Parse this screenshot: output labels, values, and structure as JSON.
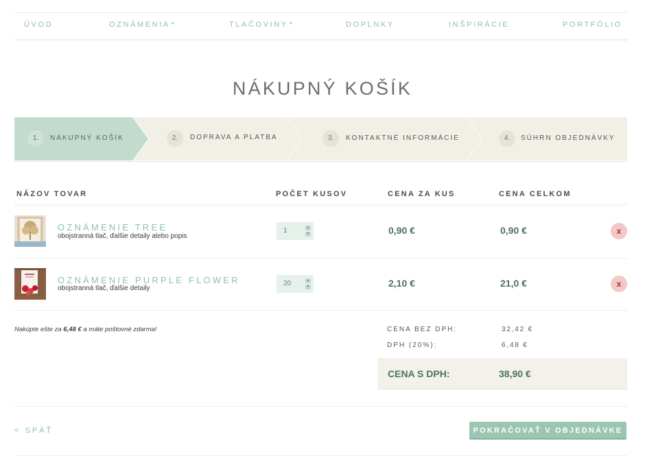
{
  "nav": {
    "items": [
      {
        "label": "ÚVOD",
        "has_dropdown": false
      },
      {
        "label": "OZNÁMENIA",
        "has_dropdown": true
      },
      {
        "label": "TLAČOVINY",
        "has_dropdown": true
      },
      {
        "label": "DOPLNKY",
        "has_dropdown": false
      },
      {
        "label": "INŠPIRÁCIE",
        "has_dropdown": false
      },
      {
        "label": "PORTFÓLIO",
        "has_dropdown": false
      }
    ],
    "caret": "▼"
  },
  "page": {
    "title": "NÁKUPNÝ KOŠÍK"
  },
  "steps": [
    {
      "number": "1.",
      "label": "NÁKUPNÝ KOŠÍK",
      "active": true
    },
    {
      "number": "2.",
      "label": "DOPRAVA A PLATBA",
      "active": false
    },
    {
      "number": "3.",
      "label": "KONTAKTNÉ INFORMÁCIE",
      "active": false
    },
    {
      "number": "4.",
      "label": "SÚHRN OBJEDNÁVKY",
      "active": false
    }
  ],
  "table": {
    "headers": {
      "name": "NÁZOV TOVAR",
      "qty": "POČET KUSOV",
      "unit_price": "CENA ZA KUS",
      "total": "CENA CELKOM"
    },
    "rows": [
      {
        "name": "OZNÁMENIE TREE",
        "description": "obojstranná tlač, ďalšie detaily alebo popis",
        "qty": "1",
        "unit_price": "0,90 €",
        "total": "0,90 €",
        "remove": "x"
      },
      {
        "name": "OZNÁMENIE PURPLE FLOWER",
        "description": "obojstranná tlač, ďalšie detaily",
        "qty": "20",
        "unit_price": "2,10 €",
        "total": "21,0 €",
        "remove": "x"
      }
    ]
  },
  "summary": {
    "note_prefix": "Nakúpte ešte za ",
    "note_amount": "6,48 €",
    "note_suffix": " a máte poštovné zdarma!",
    "subtotal_label": "CENA BEZ DPH:",
    "subtotal_value": "32,42 €",
    "vat_label": "DPH (20%):",
    "vat_value": "6,48 €",
    "total_label": "CENA S DPH:",
    "total_value": "38,90 €"
  },
  "actions": {
    "back": "< SPÄŤ",
    "continue": "POKRAČOVAŤ V OBJEDNÁVKE"
  },
  "colors": {
    "accent": "#8fbfae",
    "price": "#4c7361",
    "step_active": "#c2dbce",
    "step_inactive": "#f2efe6",
    "remove": "#f3c9c7"
  }
}
